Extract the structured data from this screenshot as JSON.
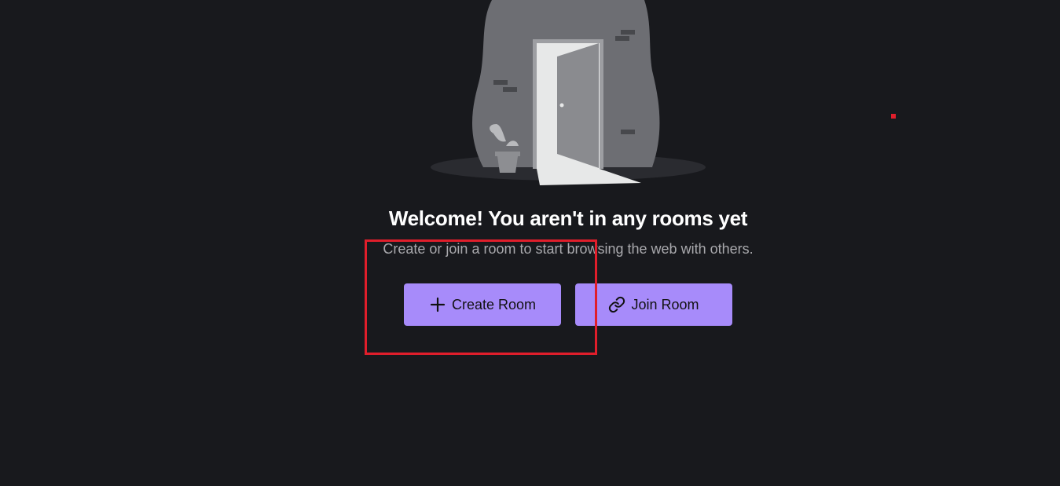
{
  "empty_state": {
    "title": "Welcome! You aren't in any rooms yet",
    "subtitle": "Create or join a room to start browsing the web with others."
  },
  "actions": {
    "create_room_label": "Create Room",
    "create_room_icon": "plus-icon",
    "join_room_label": "Join Room",
    "join_room_icon": "link-icon"
  },
  "colors": {
    "background": "#18191d",
    "button": "#a78bfa",
    "highlight": "#e01e2b"
  }
}
